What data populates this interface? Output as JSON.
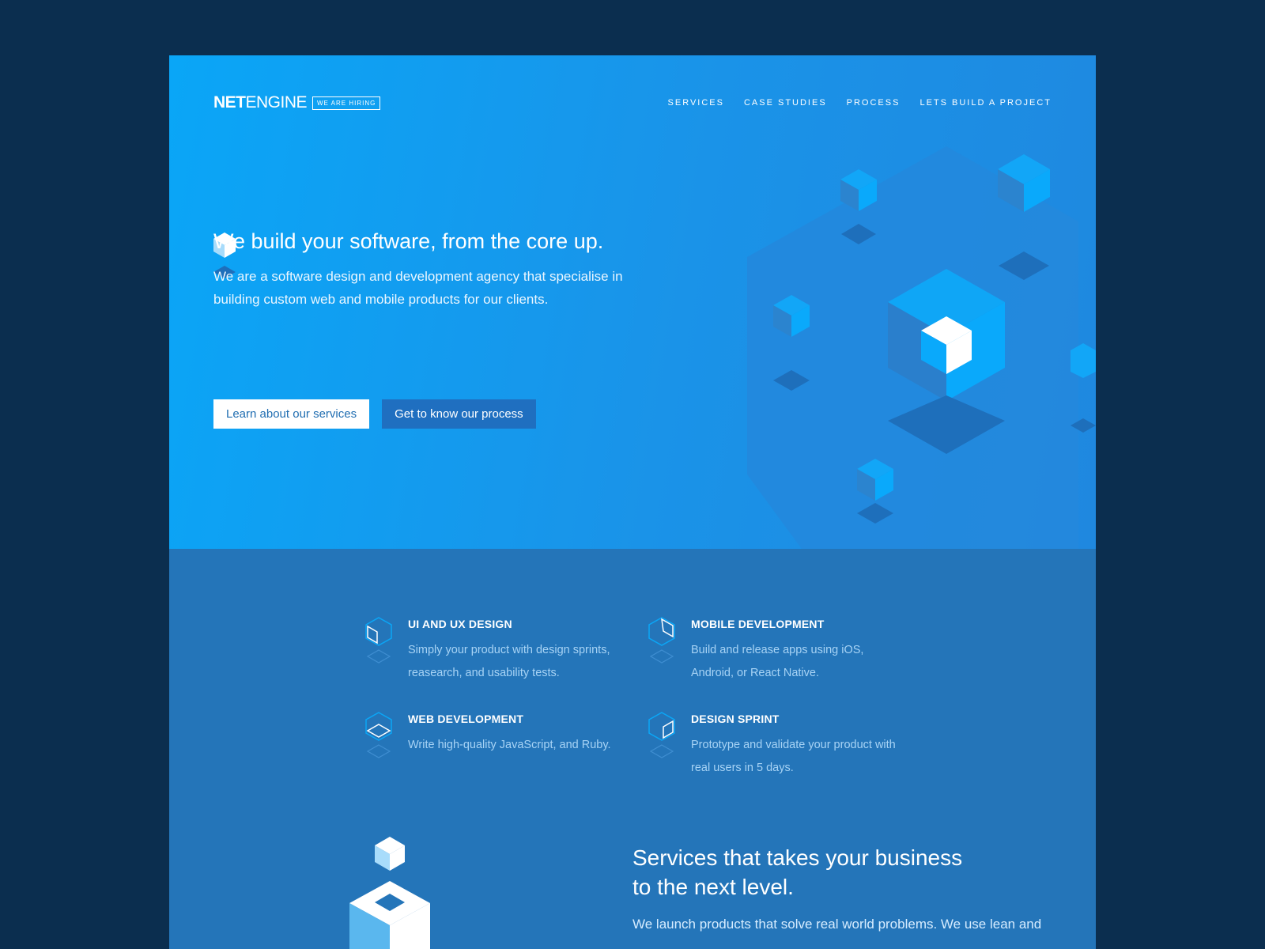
{
  "brand": {
    "logo_bold": "NET",
    "logo_light": "ENGINE",
    "hiring_badge": "WE ARE HIRING"
  },
  "nav": {
    "items": [
      "SERVICES",
      "CASE STUDIES",
      "PROCESS",
      "LETS BUILD A PROJECT"
    ]
  },
  "hero": {
    "title": "We build your software, from the core up.",
    "subtitle": "We are a software design and development agency that specialise in building  custom web and mobile products for our clients.",
    "primary_button": "Learn about our services",
    "secondary_button": "Get to know our process"
  },
  "services": {
    "items": [
      {
        "title": "UI AND UX DESIGN",
        "text": "Simply your product with design sprints, reasearch, and usability tests.",
        "icon": "cube-left-face-icon"
      },
      {
        "title": "MOBILE DEVELOPMENT",
        "text": "Build and release apps using iOS, Android, or React Native.",
        "icon": "cube-open-face-icon"
      },
      {
        "title": "WEB DEVELOPMENT",
        "text": "Write high-quality JavaScript, and Ruby.",
        "icon": "cube-top-face-icon"
      },
      {
        "title": "DESIGN SPRINT",
        "text": "Prototype and validate your product with real users in 5 days.",
        "icon": "cube-right-face-icon"
      }
    ],
    "section_title": "Services that takes your business to the next level.",
    "section_text": "We launch products that solve real world problems. We use lean and"
  },
  "colors": {
    "page_background": "#0b2e4f",
    "hero_light": "#0aa6f7",
    "hero_dark": "#1f88df",
    "services_background": "#2475b9",
    "accent_cyan": "#0ba6f6",
    "muted_text": "#a7d3f5"
  }
}
